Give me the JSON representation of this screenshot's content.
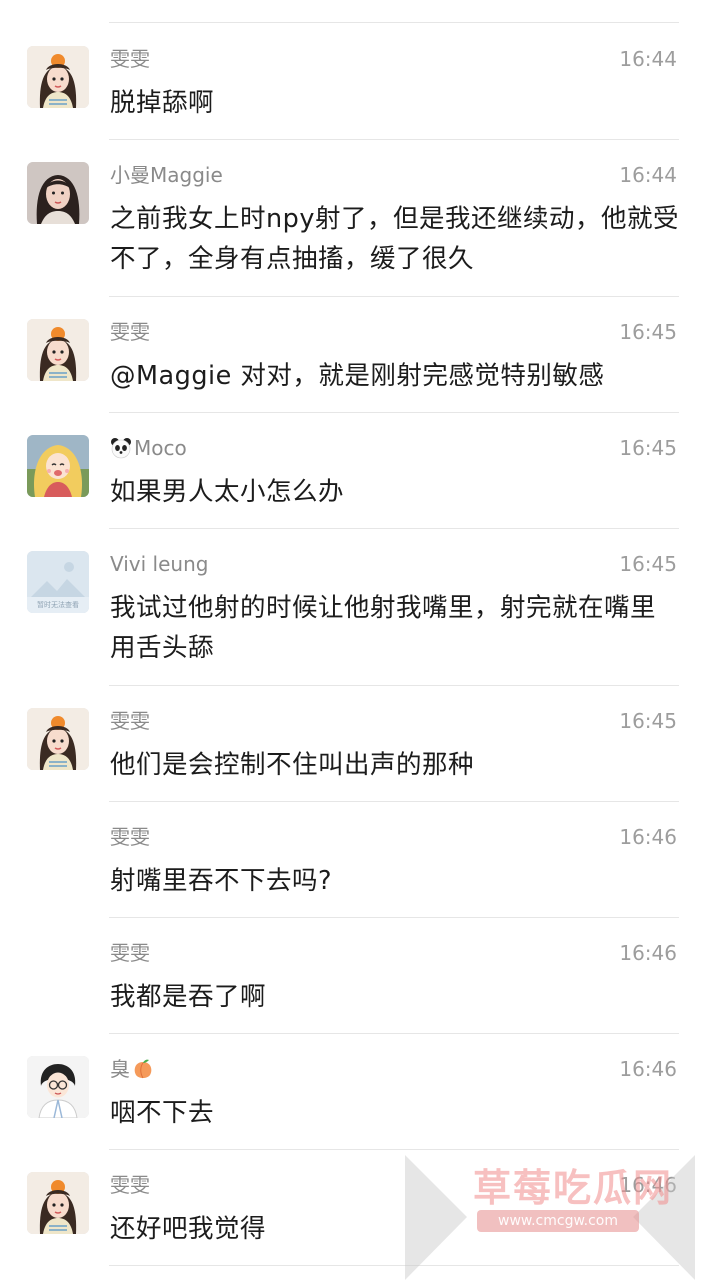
{
  "messages": [
    {
      "name": "雯雯",
      "time": "16:44",
      "text": "脱掉舔啊",
      "avatar": "girl-orange-hat-avatar"
    },
    {
      "name": "小曼Maggie",
      "time": "16:44",
      "text": "之前我女上时npy射了，但是我还继续动，他就受不了，全身有点抽搐，缓了很久",
      "avatar": "woman-photo-avatar"
    },
    {
      "name": "雯雯",
      "time": "16:45",
      "text": "@Maggie 对对，就是刚射完感觉特别敏感",
      "avatar": "girl-orange-hat-avatar"
    },
    {
      "name": "Moco",
      "name_icon": "panda-icon",
      "time": "16:45",
      "text": "如果男人太小怎么办",
      "avatar": "blonde-cartoon-avatar"
    },
    {
      "name": "Vivi leung",
      "time": "16:45",
      "text": "我试过他射的时候让他射我嘴里，射完就在嘴里用舌头舔",
      "avatar": "placeholder-image-avatar",
      "avatar_caption": "暂时无法查看"
    },
    {
      "name": "雯雯",
      "time": "16:45",
      "text": "他们是会控制不住叫出声的那种",
      "avatar": "girl-orange-hat-avatar"
    },
    {
      "name": "雯雯",
      "time": "16:46",
      "text": "射嘴里吞不下去吗?"
    },
    {
      "name": "雯雯",
      "time": "16:46",
      "text": "我都是吞了啊"
    },
    {
      "name": "臭",
      "name_icon": "peach-icon",
      "time": "16:46",
      "text": "咽不下去",
      "avatar": "doctor-cartoon-avatar"
    },
    {
      "name": "雯雯",
      "time": "16:46",
      "text": "还好吧我觉得",
      "avatar": "girl-orange-hat-avatar"
    }
  ],
  "watermark": {
    "title": "草莓吃瓜网",
    "url": "www.cmcgw.com"
  },
  "colors": {
    "name": "#8a8a8a",
    "time": "#9d9d9d",
    "text": "#1c1c1c",
    "divider": "#e6e6e6",
    "watermark": "#f08c8c"
  }
}
